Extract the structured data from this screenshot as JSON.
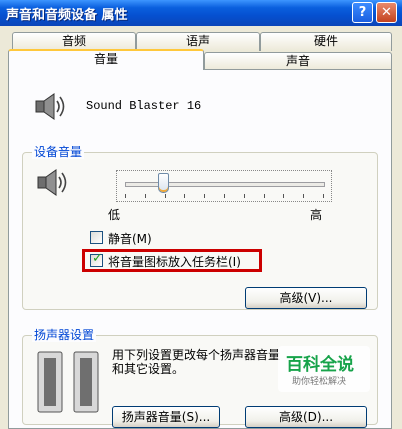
{
  "window": {
    "title": "声音和音频设备 属性",
    "help_btn": "?",
    "close_btn": "✕"
  },
  "tabs_back": [
    "音频",
    "语声",
    "硬件"
  ],
  "tabs_front": [
    "音量",
    "声音"
  ],
  "device": {
    "name": "Sound Blaster 16",
    "icon": "speaker-icon"
  },
  "device_volume": {
    "title": "设备音量",
    "low_label": "低",
    "high_label": "高",
    "level_fraction": 0.19,
    "mute_label": "静音(M)",
    "mute_checked": false,
    "taskbar_label": "将音量图标放入任务栏(I)",
    "taskbar_checked": true,
    "highlight_color": "#cc0000",
    "advanced_label": "高级(V)..."
  },
  "speaker_settings": {
    "title": "扬声器设置",
    "description": "用下列设置更改每个扬声器音量和其它设置。",
    "volume_label": "扬声器音量(S)...",
    "advanced_label": "高级(D)..."
  },
  "watermark": {
    "title": "百科全说",
    "subtitle": "助你轻松解决",
    "color": "#17a34a"
  }
}
